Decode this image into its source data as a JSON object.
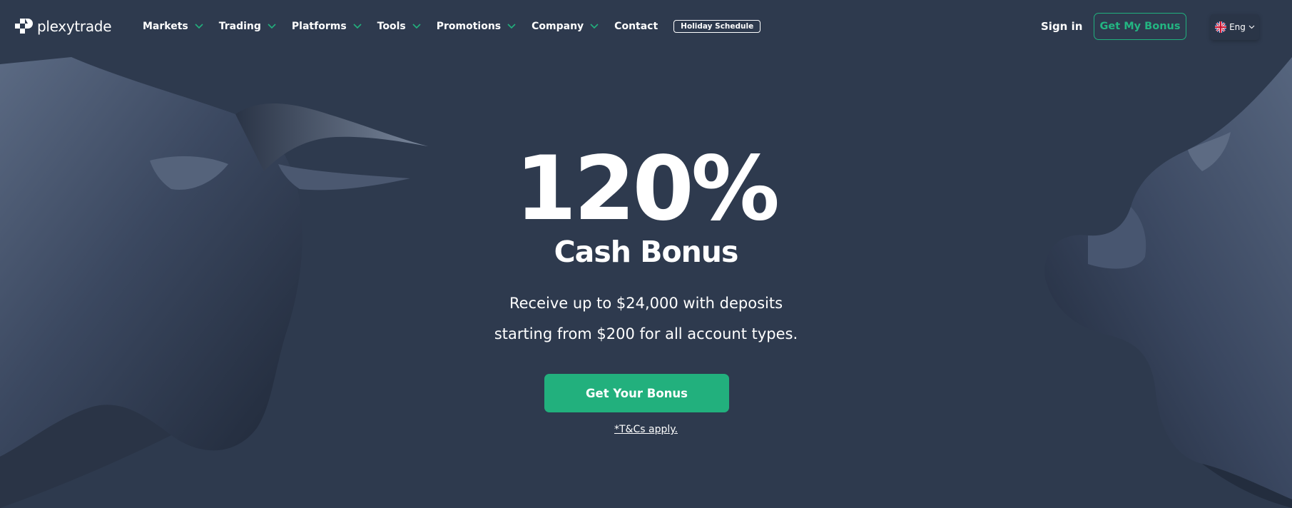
{
  "brand": {
    "name": "plexytrade"
  },
  "nav": {
    "items": [
      {
        "label": "Markets",
        "dropdown": true
      },
      {
        "label": "Trading",
        "dropdown": true
      },
      {
        "label": "Platforms",
        "dropdown": true
      },
      {
        "label": "Tools",
        "dropdown": true
      },
      {
        "label": "Promotions",
        "dropdown": true
      },
      {
        "label": "Company",
        "dropdown": true
      },
      {
        "label": "Contact",
        "dropdown": false
      }
    ],
    "holiday_label": "Holiday Schedule"
  },
  "header": {
    "signin_label": "Sign in",
    "bonus_button_label": "Get My Bonus",
    "language": "Eng"
  },
  "hero": {
    "headline": "120%",
    "subheadline": "Cash Bonus",
    "description_line1": "Receive up to $24,000 with deposits",
    "description_line2": "starting from $200 for all account types.",
    "cta_label": "Get Your Bonus",
    "terms_label": "*T&Cs apply."
  },
  "colors": {
    "background": "#2e3a4e",
    "accent": "#22b07d",
    "text": "#ffffff"
  },
  "icons": [
    "logo-icon",
    "chevron-down-icon",
    "uk-flag-icon",
    "bull-image",
    "bear-image"
  ]
}
